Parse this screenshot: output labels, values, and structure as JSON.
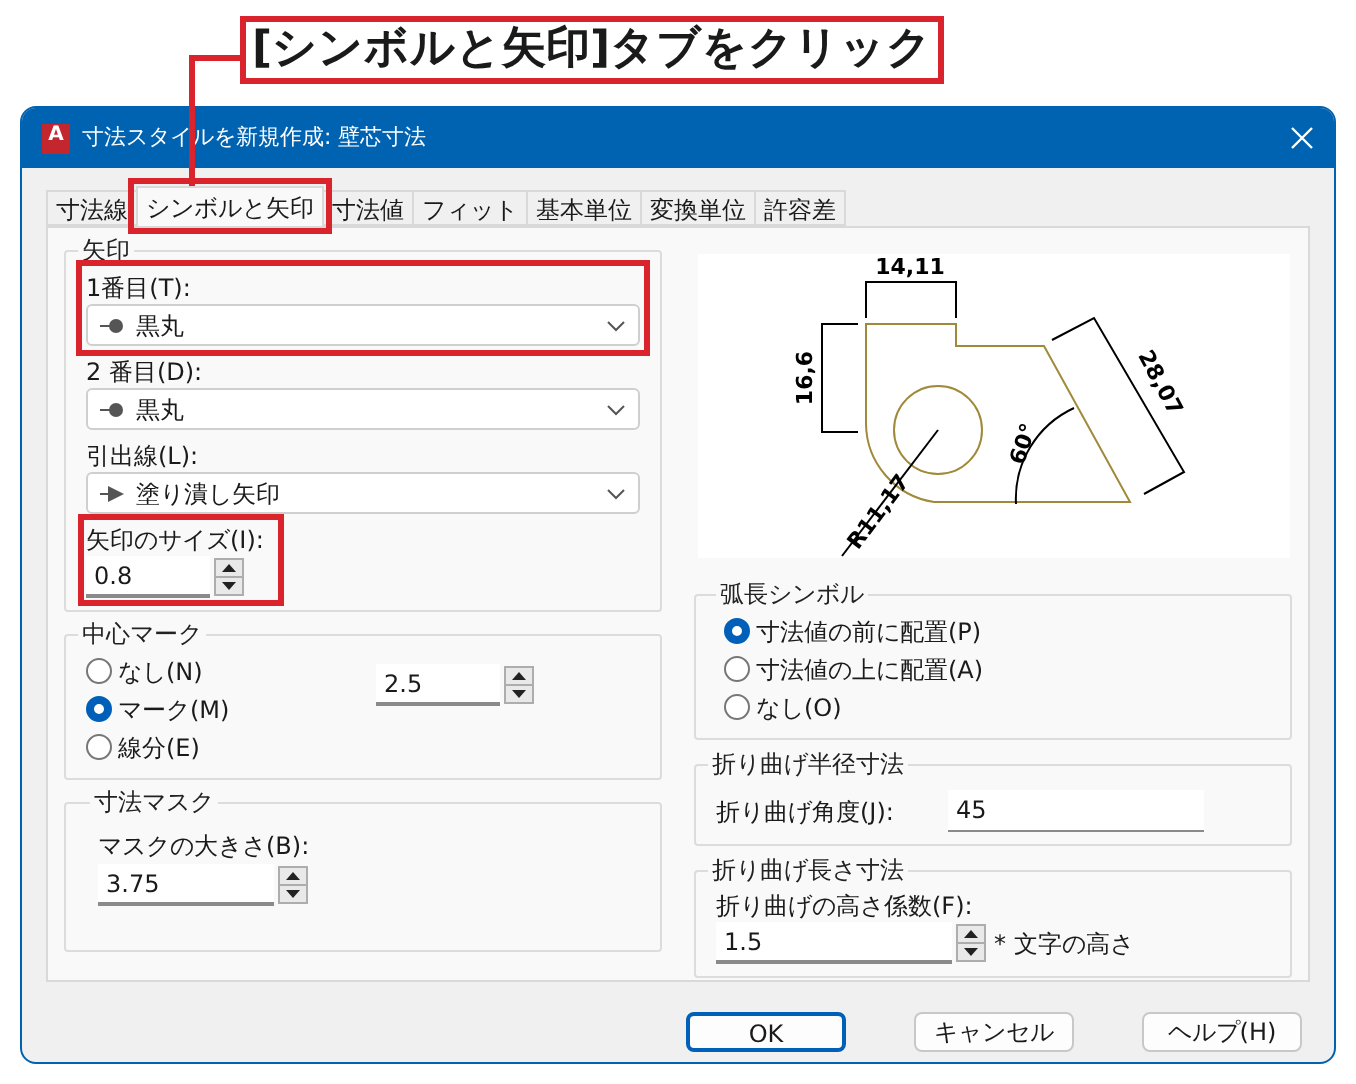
{
  "callout": {
    "text": "[シンボルと矢印]タブをクリック"
  },
  "window": {
    "title": "寸法スタイルを新規作成: 壁芯寸法",
    "icon_text": "A"
  },
  "tabs": [
    {
      "label": "寸法線",
      "selected": false,
      "highlighted": false
    },
    {
      "label": "シンボルと矢印",
      "selected": true,
      "highlighted": true
    },
    {
      "label": "寸法値",
      "selected": false,
      "highlighted": false
    },
    {
      "label": "フィット",
      "selected": false,
      "highlighted": false
    },
    {
      "label": "基本単位",
      "selected": false,
      "highlighted": false
    },
    {
      "label": "変換単位",
      "selected": false,
      "highlighted": false
    },
    {
      "label": "許容差",
      "selected": false,
      "highlighted": false
    }
  ],
  "arrowheads": {
    "title": "矢印",
    "fields": [
      {
        "label": "1番目(T):",
        "value": "黒丸",
        "kind": "dot",
        "highlighted": true
      },
      {
        "label": "2 番目(D):",
        "value": "黒丸",
        "kind": "dot",
        "highlighted": false
      },
      {
        "label": "引出線(L):",
        "value": "塗り潰し矢印",
        "kind": "arrow",
        "highlighted": false
      }
    ],
    "size": {
      "label": "矢印のサイズ(I):",
      "value": "0.8",
      "highlighted": true
    }
  },
  "center_mark": {
    "title": "中心マーク",
    "options": [
      {
        "label": "なし(N)",
        "selected": false
      },
      {
        "label": "マーク(M)",
        "selected": true
      },
      {
        "label": "線分(E)",
        "selected": false
      }
    ],
    "value": "2.5"
  },
  "dimension_mask": {
    "title": "寸法マスク",
    "label": "マスクの大きさ(B):",
    "value": "3.75"
  },
  "preview": {
    "labels": [
      "14,11",
      "16,6",
      "28,07",
      "60°",
      "R11,17"
    ]
  },
  "arc_length_symbol": {
    "title": "弧長シンボル",
    "options": [
      {
        "label": "寸法値の前に配置(P)",
        "selected": true
      },
      {
        "label": "寸法値の上に配置(A)",
        "selected": false
      },
      {
        "label": "なし(O)",
        "selected": false
      }
    ]
  },
  "radius_jog": {
    "title": "折り曲げ半径寸法",
    "label": "折り曲げ角度(J):",
    "value": "45"
  },
  "linear_jog": {
    "title": "折り曲げ長さ寸法",
    "label": "折り曲げの高さ係数(F):",
    "value": "1.5",
    "suffix": "* 文字の高さ"
  },
  "buttons": [
    {
      "label": "OK",
      "default": true
    },
    {
      "label": "キャンセル",
      "default": false
    },
    {
      "label": "ヘルプ(H)",
      "default": false
    }
  ]
}
